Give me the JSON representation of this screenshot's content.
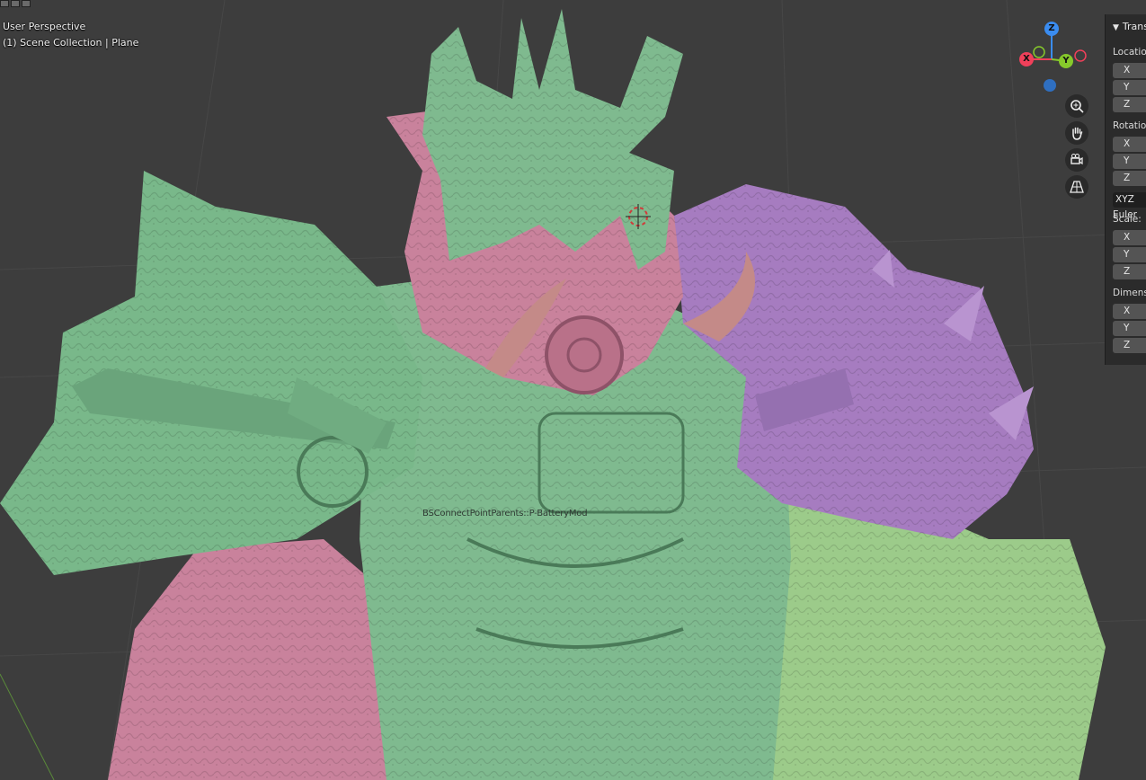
{
  "viewport": {
    "view_mode": "User Perspective",
    "collection_info": "(1) Scene Collection | Plane",
    "object_label": "BSConnectPointParents::P-BatteryMod"
  },
  "gizmo": {
    "x_label": "X",
    "y_label": "Y",
    "z_label": "Z",
    "colors": {
      "x": "#f0405a",
      "y": "#86c92b",
      "z": "#3a8cf0",
      "neg_z": "#2f6fc0"
    }
  },
  "nav_buttons": [
    {
      "icon": "zoom-icon",
      "glyph": "⊕"
    },
    {
      "icon": "hand-pan-icon",
      "glyph": "✋"
    },
    {
      "icon": "camera-icon",
      "glyph": "⎈"
    },
    {
      "icon": "perspective-grid-icon",
      "glyph": "▦"
    }
  ],
  "npanel": {
    "header": "Transform",
    "location_label": "Location",
    "rotation_label": "Rotation",
    "rotation_mode": "XYZ Euler",
    "scale_label": "Scale:",
    "dimensions_label": "Dimensions",
    "axes": [
      "X",
      "Y",
      "Z"
    ]
  },
  "colors": {
    "background": "#3d3d3d",
    "green_mesh": "#7fba8f",
    "pink_mesh": "#c9829c",
    "purple_mesh": "#a67cc0",
    "light_green_mesh": "#9ccb8a"
  }
}
